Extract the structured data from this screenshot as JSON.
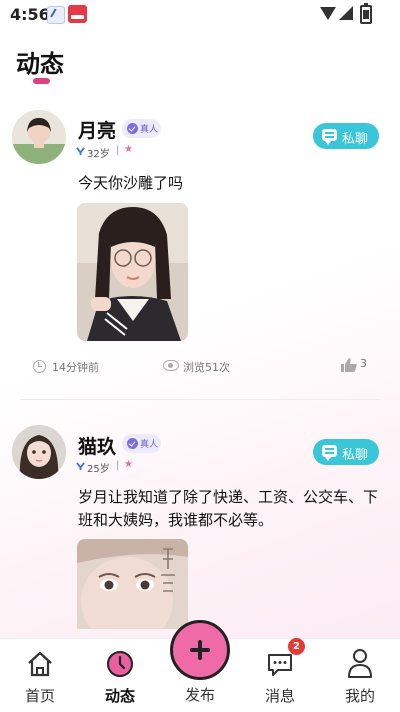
{
  "status_bar": {
    "time": "4:56"
  },
  "header": {
    "title": "动态"
  },
  "posts": [
    {
      "name": "月亮",
      "badge": "真人",
      "age": "32岁",
      "separator": "|",
      "chat_label": "私聊",
      "text": "今天你沙雕了吗",
      "time_ago": "14分钟前",
      "views": "浏览51次",
      "likes": "3"
    },
    {
      "name": "猫玖",
      "badge": "真人",
      "age": "25岁",
      "separator": "|",
      "chat_label": "私聊",
      "text": "岁月让我知道了除了快递、工资、公交车、下班和大姨妈，我谁都不必等。"
    }
  ],
  "tabbar": {
    "home": "首页",
    "dynamic": "动态",
    "publish": "发布",
    "messages": "消息",
    "messages_badge": "2",
    "mine": "我的"
  },
  "colors": {
    "accent_pink": "#e0407f",
    "chat_button": "#38c6d8",
    "publish_button": "#f06aa8",
    "badge_red": "#e53935"
  }
}
